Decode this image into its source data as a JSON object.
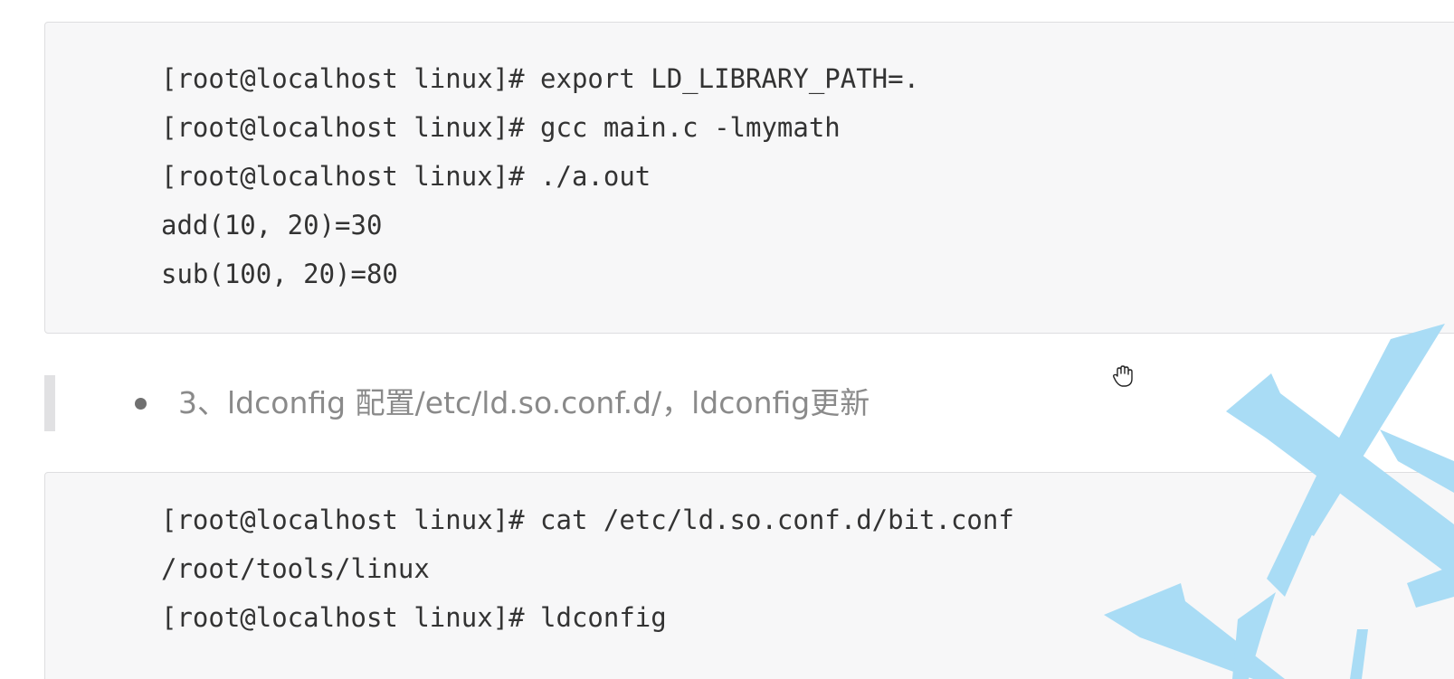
{
  "code_block_1": {
    "lines": [
      "[root@localhost linux]# export LD_LIBRARY_PATH=.",
      "[root@localhost linux]# gcc main.c -lmymath",
      "[root@localhost linux]# ./a.out",
      "add(10, 20)=30",
      "sub(100, 20)=80"
    ]
  },
  "list": {
    "items": [
      {
        "text": "3、ldconfig 配置/etc/ld.so.conf.d/，ldconfig更新"
      }
    ]
  },
  "code_block_2": {
    "lines": [
      "[root@localhost linux]# cat /etc/ld.so.conf.d/bit.conf",
      "/root/tools/linux",
      "[root@localhost linux]# ldconfig"
    ]
  },
  "colors": {
    "code_background": "#f7f7f8",
    "code_text": "#333333",
    "list_text": "#8a8a8a",
    "watermark": "#a9dcf5"
  },
  "icons": {
    "cursor": "hand-grab-cursor-icon",
    "bullet": "bullet-dot"
  }
}
